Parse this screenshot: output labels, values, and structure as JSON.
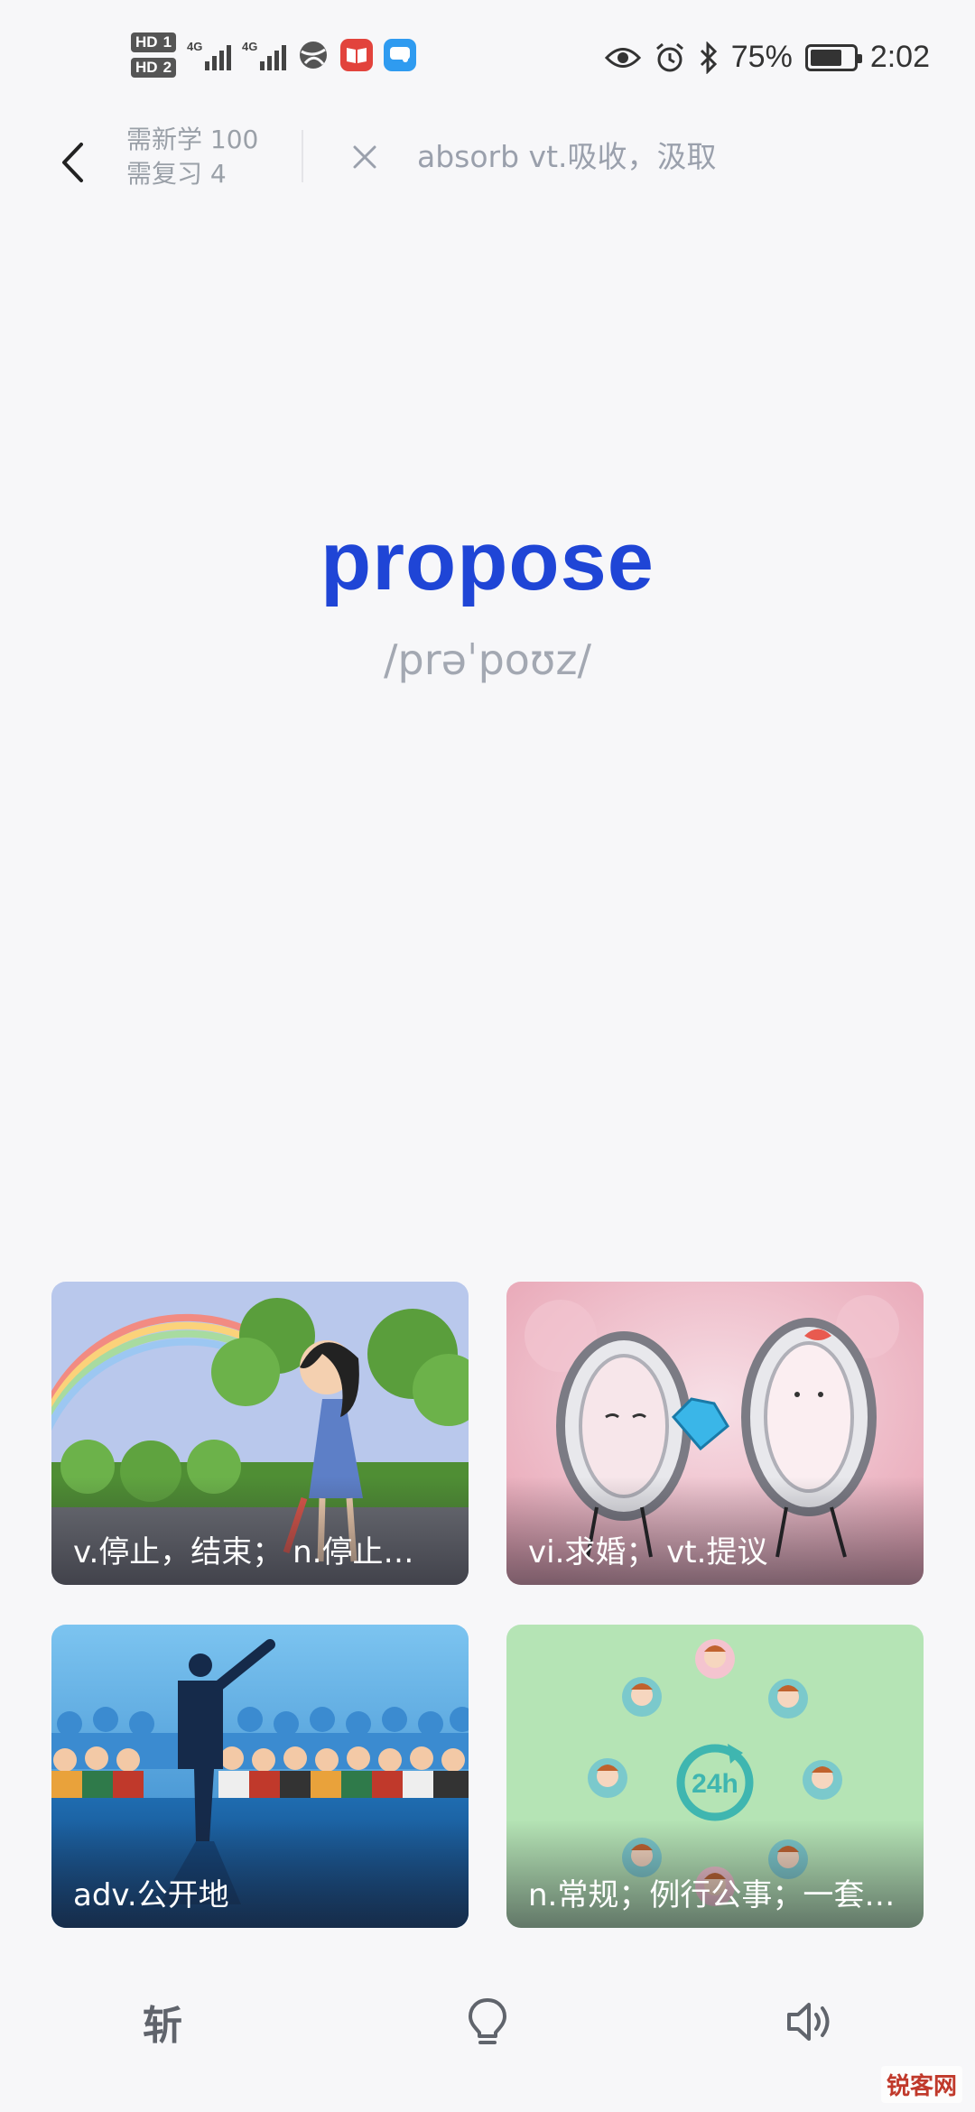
{
  "status_bar": {
    "hd1": "HD",
    "sim1": "1",
    "hd2": "HD",
    "sim2": "2",
    "net1": "4G",
    "net2": "4G",
    "battery_percent": "75%",
    "battery_level": 0.75,
    "time": "2:02"
  },
  "header": {
    "new_count": "需新学 100",
    "review_count": "需复习 4",
    "previous_word": "absorb vt.吸收，汲取"
  },
  "word": {
    "text": "propose",
    "phonetic": "/prəˈpoʊz/"
  },
  "options": [
    {
      "caption": "v.停止，结束；  n.停止…",
      "scene": "girl-with-umbrella"
    },
    {
      "caption": "vi.求婚；  vt.提议",
      "scene": "rings-proposal"
    },
    {
      "caption": "adv.公开地",
      "scene": "speaker-crowd"
    },
    {
      "caption": "n.常规；例行公事；一套…",
      "scene": "routine-24h"
    }
  ],
  "bottom_bar": {
    "zhan_label": "斩",
    "hint_icon": "lightbulb-icon",
    "sound_icon": "speaker-icon"
  },
  "watermark": "锐客网",
  "colors": {
    "word": "#1f45d6",
    "phonetic": "#a3a8b2",
    "background": "#f7f7f9"
  }
}
